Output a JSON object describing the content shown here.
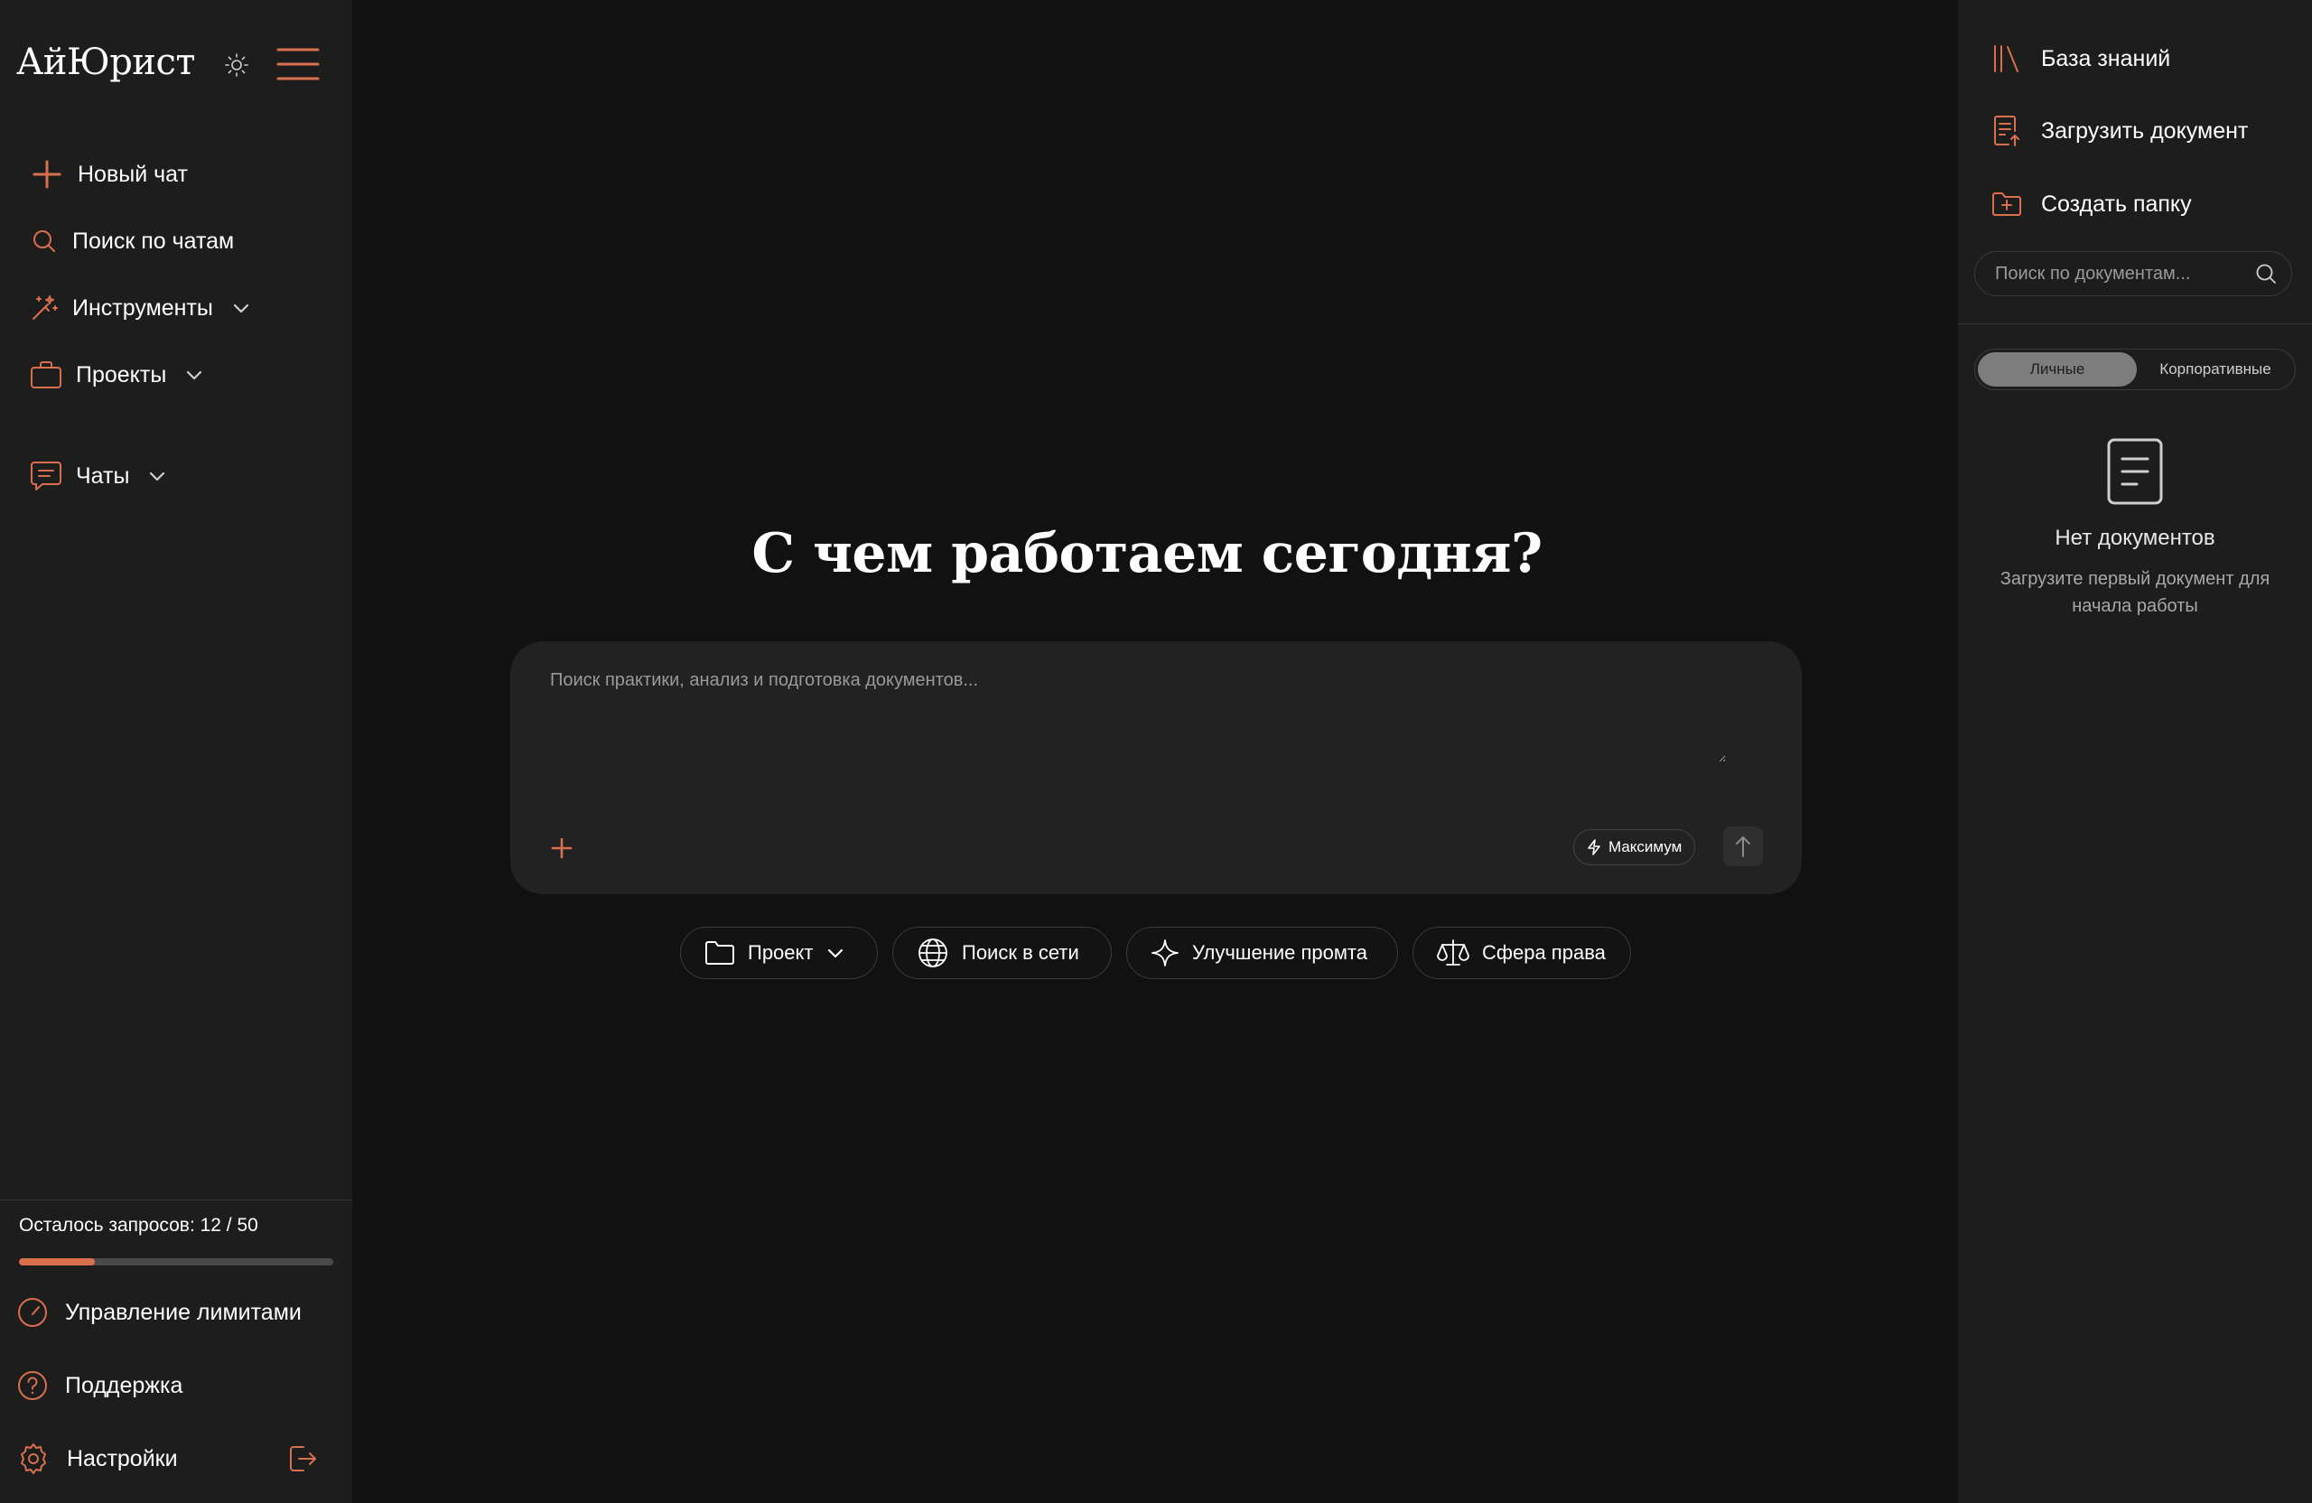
{
  "app": {
    "logo": "АйЮрист"
  },
  "sidebar": {
    "new_chat": "Новый чат",
    "search_chats": "Поиск по чатам",
    "tools": "Инструменты",
    "projects": "Проекты",
    "chats": "Чаты"
  },
  "usage": {
    "label": "Осталось запросов: 12 / 50",
    "remaining": 12,
    "total": 50
  },
  "bottom_nav": {
    "limits": "Управление лимитами",
    "support": "Поддержка",
    "settings": "Настройки"
  },
  "main": {
    "headline": "С чем работаем сегодня?",
    "composer_placeholder": "Поиск практики, анализ и подготовка документов...",
    "mode_label": "Максимум",
    "chips": {
      "project": "Проект",
      "web_search": "Поиск в сети",
      "improve_prompt": "Улучшение промта",
      "law_area": "Сфера права"
    }
  },
  "right_panel": {
    "knowledge_base": "База знаний",
    "upload_document": "Загрузить документ",
    "create_folder": "Создать папку",
    "doc_search_placeholder": "Поиск по документам...",
    "tab_personal": "Личные",
    "tab_corporate": "Корпоративные",
    "active_tab": "Личные",
    "empty_title": "Нет документов",
    "empty_subtitle": "Загрузите первый документ для начала работы"
  },
  "colors": {
    "accent": "#d8704e",
    "background": "#111111",
    "panel": "#1d1d1d",
    "composer": "#222222"
  }
}
